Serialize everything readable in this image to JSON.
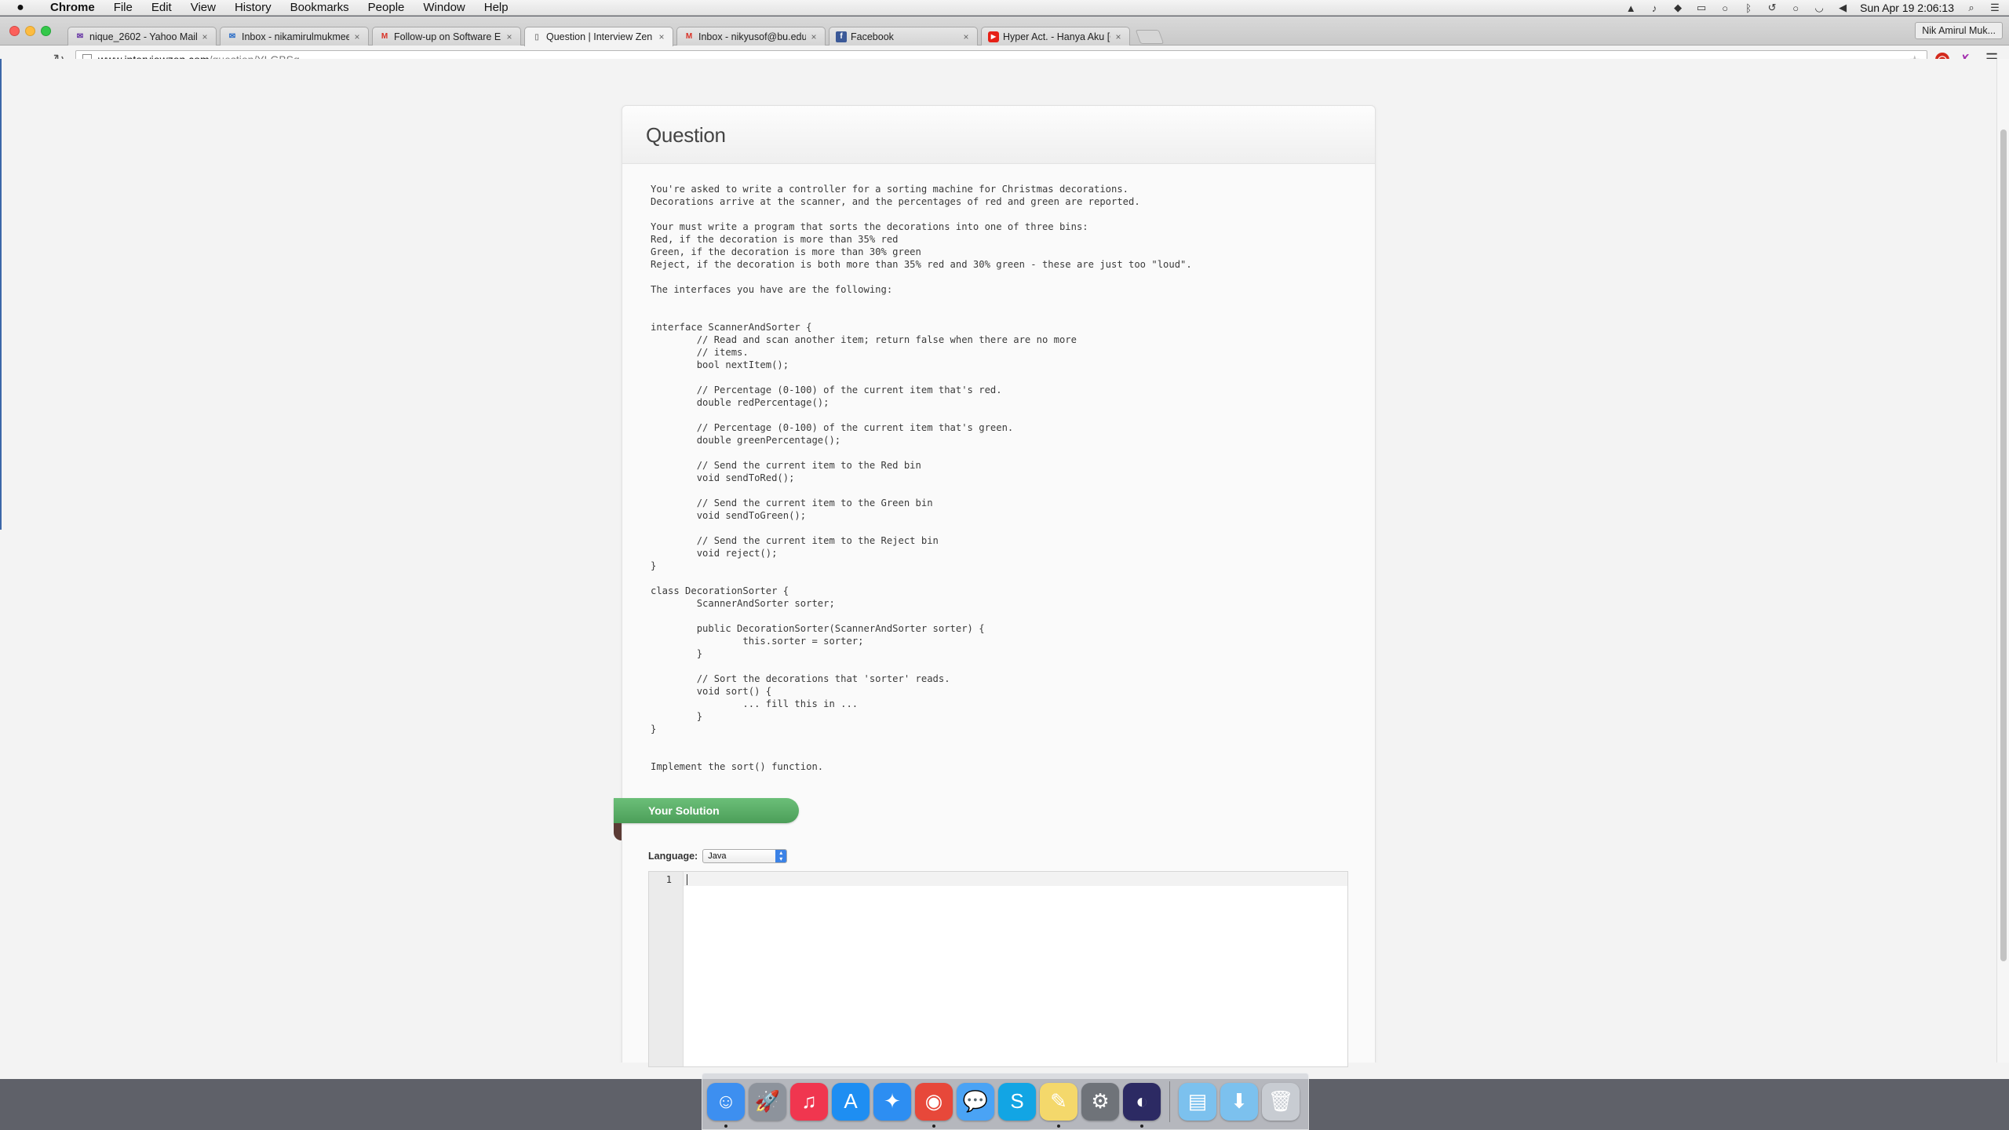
{
  "menubar": {
    "app_name": "Chrome",
    "menus": [
      "File",
      "Edit",
      "View",
      "History",
      "Bookmarks",
      "People",
      "Window",
      "Help"
    ],
    "clock": "Sun Apr 19  2:06:13"
  },
  "tabs": [
    {
      "title": "nique_2602 - Yahoo Mail",
      "favicon": "yahoo-mail-icon",
      "active": false
    },
    {
      "title": "Inbox - nikamirulmukmee",
      "favicon": "outlook-icon",
      "active": false
    },
    {
      "title": "Follow-up on Software Eng",
      "favicon": "gmail-icon",
      "active": false
    },
    {
      "title": "Question | Interview Zen",
      "favicon": "page-icon",
      "active": true
    },
    {
      "title": "Inbox - nikyusof@bu.edu",
      "favicon": "gmail-icon",
      "active": false
    },
    {
      "title": "Facebook",
      "favicon": "facebook-icon",
      "active": false
    },
    {
      "title": "Hyper Act. - Hanya Aku [O",
      "favicon": "youtube-icon",
      "active": false
    }
  ],
  "profile_name": "Nik Amirul Muk...",
  "address_bar": {
    "host": "www.interviewzen.com",
    "path": "/question/YLGBSq"
  },
  "question": {
    "heading": "Question",
    "body": "You're asked to write a controller for a sorting machine for Christmas decorations.\nDecorations arrive at the scanner, and the percentages of red and green are reported.\n\nYour must write a program that sorts the decorations into one of three bins:\nRed, if the decoration is more than 35% red\nGreen, if the decoration is more than 30% green\nReject, if the decoration is both more than 35% red and 30% green - these are just too \"loud\".\n\nThe interfaces you have are the following:\n\n\ninterface ScannerAndSorter {\n        // Read and scan another item; return false when there are no more\n        // items.\n        bool nextItem();\n\n        // Percentage (0-100) of the current item that's red.\n        double redPercentage();\n\n        // Percentage (0-100) of the current item that's green.\n        double greenPercentage();\n\n        // Send the current item to the Red bin\n        void sendToRed();\n\n        // Send the current item to the Green bin\n        void sendToGreen();\n\n        // Send the current item to the Reject bin\n        void reject();\n}\n\nclass DecorationSorter {\n        ScannerAndSorter sorter;\n\n        public DecorationSorter(ScannerAndSorter sorter) {\n                this.sorter = sorter;\n        }\n\n        // Sort the decorations that 'sorter' reads.\n        void sort() {\n                ... fill this in ...\n        }\n}\n\n\nImplement the sort() function."
  },
  "solution": {
    "banner": "Your Solution",
    "language_label": "Language:",
    "language_value": "Java",
    "line_number": "1"
  },
  "dock": [
    {
      "name": "finder-icon",
      "color": "#3d8ff0",
      "glyph": "☺",
      "running": true
    },
    {
      "name": "launchpad-icon",
      "color": "#8d939c",
      "glyph": "🚀",
      "running": false
    },
    {
      "name": "itunes-icon",
      "color": "#f0364f",
      "glyph": "♫",
      "running": false
    },
    {
      "name": "app-store-icon",
      "color": "#1e8ef2",
      "glyph": "A",
      "running": false
    },
    {
      "name": "safari-icon",
      "color": "#2d8ef2",
      "glyph": "✦",
      "running": false
    },
    {
      "name": "chrome-icon",
      "color": "#e7483a",
      "glyph": "◉",
      "running": true
    },
    {
      "name": "messages-icon",
      "color": "#4aa3f5",
      "glyph": "💬",
      "running": false
    },
    {
      "name": "skype-icon",
      "color": "#12a5e4",
      "glyph": "S",
      "running": false
    },
    {
      "name": "stickies-icon",
      "color": "#f4d86b",
      "glyph": "✎",
      "running": true
    },
    {
      "name": "system-preferences-icon",
      "color": "#6f7379",
      "glyph": "⚙",
      "running": false
    },
    {
      "name": "eclipse-icon",
      "color": "#2c2a63",
      "glyph": "◐",
      "running": true
    },
    {
      "name": "documents-folder-icon",
      "color": "#7cc1ee",
      "glyph": "▤",
      "running": false
    },
    {
      "name": "downloads-folder-icon",
      "color": "#7cc1ee",
      "glyph": "⬇",
      "running": false
    },
    {
      "name": "trash-icon",
      "color": "#c8ccd2",
      "glyph": "🗑",
      "running": false
    }
  ],
  "colors": {
    "solution_banner": "#5cb068",
    "select_accent": "#3b82e6"
  }
}
